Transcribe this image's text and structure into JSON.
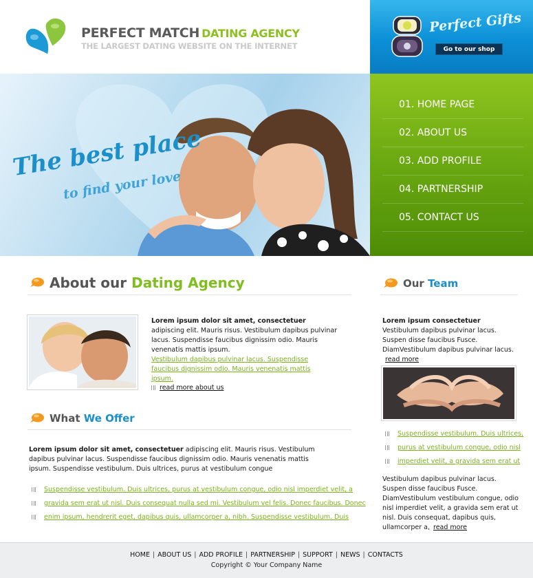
{
  "header": {
    "brand_main": "PERFECT MATCH",
    "brand_accent": "DATING AGENCY",
    "tagline": "THE LARGEST DATING WEBSITE ON THE INTERNET"
  },
  "gifts": {
    "title": "Perfect Gifts",
    "button": "Go to our shop"
  },
  "hero": {
    "line1": "The best place",
    "line2": "to find your love"
  },
  "nav": {
    "items": [
      {
        "label": "01. HOME PAGE"
      },
      {
        "label": "02. ABOUT US"
      },
      {
        "label": "03. ADD PROFILE"
      },
      {
        "label": "04. PARTNERSHIP"
      },
      {
        "label": "05. CONTACT US"
      }
    ]
  },
  "about": {
    "heading_a": "About our",
    "heading_b": "Dating Agency",
    "bold": "Lorem ipsum dolor sit amet, consectetuer",
    "text": " adipiscing elit. Mauris risus. Vestibulum dapibus pulvinar lacus. Suspendisse faucibus dignissim odio. Mauris venenatis mattis ipsum.",
    "link_text": "Vestibulum dapibus pulvinar lacus. Suspendisse faucibus dignissim odio. Mauris venenatis mattis ipsum.",
    "read_more": "read more about us"
  },
  "offer": {
    "heading_a": "What",
    "heading_b": "We Offer",
    "bold": "Lorem ipsum dolor sit amet, consectetuer",
    "text": " adipiscing elit. Mauris risus. Vestibulum dapibus pulvinar lacus. Suspendisse faucibus dignissim odio. Mauris venenatis mattis ipsum. Suspendisse vestibulum. Duis ultrices, purus at vestibulum congue",
    "links": [
      "Suspendisse vestibulum. Duis ultrices, purus at vestibulum congue, odio nisl imperdiet velit, a",
      "gravida sem erat ut nisl. Duis consequat nulla sed mi. Vestibulum vel felis. Donec faucibus. Donec",
      "enim ipsum, hendrerit eget, dapibus quis, ullamcorper a, nibh. Suspendisse vestibulum. Duis"
    ]
  },
  "team": {
    "heading_a": "Our",
    "heading_b": "Team",
    "bold": "Lorem ipsum consectetuer",
    "text": "Vestibulum dapibus pulvinar lacus. Suspen disse faucibus Fusce. DiamVestibulum dapibus pulvinar lacus.",
    "read_more": "read more",
    "links": [
      "Suspendisse vestibulum. Duis ultrices,",
      "purus at vestibulum congue, odio nisl",
      "imperdiet velit, a gravida sem erat ut"
    ],
    "text2": "Vestibulum dapibus pulvinar lacus. Suspen disse faucibus Fusce. DiamVestibulum vestibulum congue, odio nisl imperdiet velit, a gravida sem erat ut nisl. Duis consequat, dapibus quis, ullamcorper a,",
    "read_more2": "read more"
  },
  "footer": {
    "links": [
      "HOME",
      "ABOUT US",
      "ADD PROFILE",
      "PARTNERSHIP",
      "SUPPORT",
      "NEWS",
      "CONTACTS"
    ],
    "copyright": "Copyright © Your Company Name"
  },
  "colors": {
    "green_accent": "#80bd1f",
    "blue_accent": "#1c8ec9",
    "nav_green": "#6aa811",
    "gifts_blue": "#0b8fd6"
  }
}
